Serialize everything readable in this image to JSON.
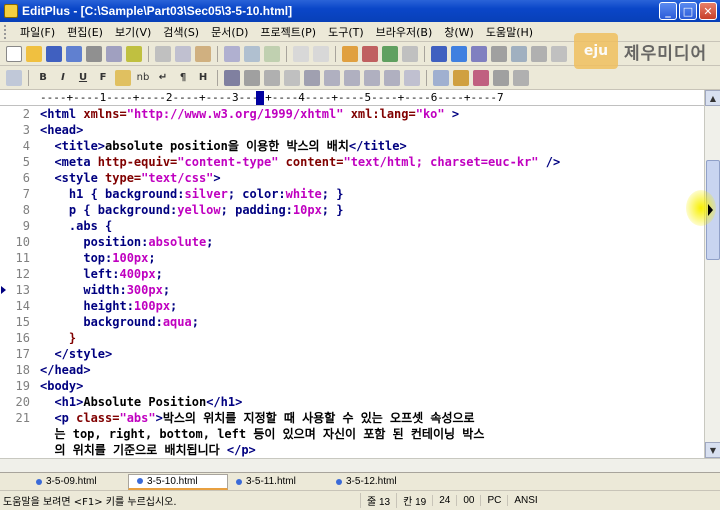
{
  "window": {
    "title": "EditPlus - [C:\\Sample\\Part03\\Sec05\\3-5-10.html]",
    "minimize": "_",
    "maximize": "□",
    "close": "✕"
  },
  "menu": [
    "파일(F)",
    "편집(E)",
    "보기(V)",
    "검색(S)",
    "문서(D)",
    "프로젝트(P)",
    "도구(T)",
    "브라우저(B)",
    "창(W)",
    "도움말(H)"
  ],
  "toolbar2_labels": [
    "B",
    "I",
    "U",
    "F",
    "nb",
    "↵",
    "¶",
    "H"
  ],
  "logo": {
    "badge": "eju",
    "brand": "제우미디어"
  },
  "ruler": "----+----1----+----2----+----3----+----4----+----5----+----6----+----7",
  "lines": [
    {
      "n": "2",
      "parts": [
        [
          "tag",
          "<html "
        ],
        [
          "attr",
          "xmlns="
        ],
        [
          "str",
          "\"http://www.w3.org/1999/xhtml\""
        ],
        [
          "attr",
          " xml:lang="
        ],
        [
          "str",
          "\"ko\""
        ],
        [
          "tag",
          " >"
        ]
      ]
    },
    {
      "n": "3",
      "parts": [
        [
          "tag",
          "<head>"
        ]
      ]
    },
    {
      "n": "4",
      "parts": [
        [
          "tag",
          "  <title>"
        ],
        [
          "txt",
          "absolute position을 이용한 박스의 배치"
        ],
        [
          "tag",
          "</title>"
        ]
      ]
    },
    {
      "n": "5",
      "parts": [
        [
          "tag",
          "  <meta "
        ],
        [
          "attr",
          "http-equiv="
        ],
        [
          "str",
          "\"content-type\""
        ],
        [
          "attr",
          " content="
        ],
        [
          "str",
          "\"text/html; charset=euc-kr\""
        ],
        [
          "tag",
          " />"
        ]
      ]
    },
    {
      "n": "6",
      "parts": [
        [
          "tag",
          "  <style "
        ],
        [
          "attr",
          "type="
        ],
        [
          "str",
          "\"text/css\""
        ],
        [
          "tag",
          ">"
        ]
      ]
    },
    {
      "n": "7",
      "parts": [
        [
          "prop",
          "    h1 { background:"
        ],
        [
          "val",
          "silver"
        ],
        [
          "prop",
          "; color:"
        ],
        [
          "val",
          "white"
        ],
        [
          "prop",
          "; }"
        ]
      ]
    },
    {
      "n": "8",
      "parts": [
        [
          "prop",
          "    p { background:"
        ],
        [
          "val",
          "yellow"
        ],
        [
          "prop",
          "; padding:"
        ],
        [
          "val",
          "10px"
        ],
        [
          "prop",
          "; }"
        ]
      ]
    },
    {
      "n": "9",
      "parts": [
        [
          "prop",
          "    .abs {"
        ]
      ]
    },
    {
      "n": "10",
      "parts": [
        [
          "prop",
          "      position:"
        ],
        [
          "val",
          "absolute"
        ],
        [
          "prop",
          ";"
        ]
      ]
    },
    {
      "n": "11",
      "parts": [
        [
          "prop",
          "      top:"
        ],
        [
          "val",
          "100px"
        ],
        [
          "prop",
          ";"
        ]
      ]
    },
    {
      "n": "12",
      "parts": [
        [
          "prop",
          "      left:"
        ],
        [
          "val",
          "400px"
        ],
        [
          "prop",
          ";"
        ]
      ]
    },
    {
      "n": "13",
      "parts": [
        [
          "prop",
          "      width:"
        ],
        [
          "val",
          "300px"
        ],
        [
          "prop",
          ";"
        ]
      ],
      "current": true
    },
    {
      "n": "14",
      "parts": [
        [
          "prop",
          "      height:"
        ],
        [
          "val",
          "100px"
        ],
        [
          "prop",
          ";"
        ]
      ]
    },
    {
      "n": "15",
      "parts": [
        [
          "prop",
          "      background:"
        ],
        [
          "val",
          "aqua"
        ],
        [
          "prop",
          ";"
        ]
      ]
    },
    {
      "n": "16",
      "parts": [
        [
          "attr",
          "    }"
        ]
      ]
    },
    {
      "n": "17",
      "parts": [
        [
          "tag",
          "  </style>"
        ]
      ]
    },
    {
      "n": "18",
      "parts": [
        [
          "tag",
          "</head>"
        ]
      ]
    },
    {
      "n": "19",
      "parts": [
        [
          "tag",
          "<body>"
        ]
      ]
    },
    {
      "n": "20",
      "parts": [
        [
          "tag",
          "  <h1>"
        ],
        [
          "txt",
          "Absolute Position"
        ],
        [
          "tag",
          "</h1>"
        ]
      ]
    },
    {
      "n": "21",
      "parts": [
        [
          "tag",
          "  <p "
        ],
        [
          "attr",
          "class="
        ],
        [
          "str",
          "\"abs\""
        ],
        [
          "tag",
          ">"
        ],
        [
          "txt",
          "박스의 위치를 지정할 때 사용할 수 있는 오프셋 속성으로"
        ]
      ]
    },
    {
      "n": "",
      "parts": [
        [
          "txt",
          "  는 top, right, bottom, left 등이 있으며 자신이 포함 된 컨테이닝 박스"
        ]
      ]
    },
    {
      "n": "",
      "parts": [
        [
          "txt",
          "  의 위치를 기준으로 배치됩니다 "
        ],
        [
          "tag",
          "</p>"
        ]
      ]
    }
  ],
  "tabs": [
    {
      "label": "3-5-09.html",
      "active": false
    },
    {
      "label": "3-5-10.html",
      "active": true
    },
    {
      "label": "3-5-11.html",
      "active": false
    },
    {
      "label": "3-5-12.html",
      "active": false
    }
  ],
  "status": {
    "message": "도움말을 보려면 <F1> 키를 누르십시오.",
    "line": "줄 13",
    "col": "칸 19",
    "total": "24",
    "mode": "00",
    "format": "PC",
    "encoding": "ANSI"
  }
}
